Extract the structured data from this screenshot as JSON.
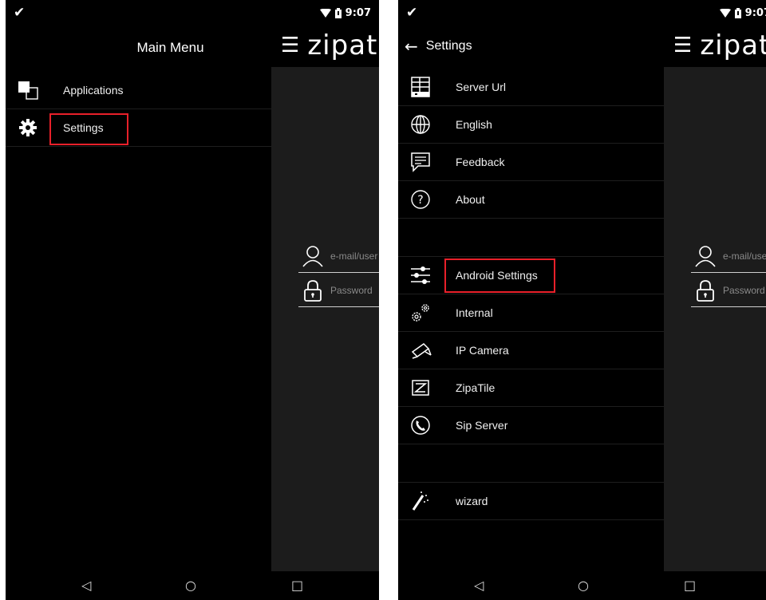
{
  "status": {
    "time": "9:07"
  },
  "app": {
    "logo": "zipato",
    "email_placeholder": "e-mail/user",
    "password_placeholder": "Password"
  },
  "left": {
    "title": "Main Menu",
    "items": [
      {
        "label": "Applications",
        "icon": "windows-icon"
      },
      {
        "label": "Settings",
        "icon": "gear-icon"
      }
    ]
  },
  "right": {
    "title": "Settings",
    "items": [
      {
        "label": "Server Url",
        "icon": "server-icon"
      },
      {
        "label": "English",
        "icon": "globe-icon"
      },
      {
        "label": "Feedback",
        "icon": "chat-icon"
      },
      {
        "label": "About",
        "icon": "question-icon"
      },
      {
        "label": "Android Settings",
        "icon": "sliders-icon"
      },
      {
        "label": "Internal",
        "icon": "gears-icon"
      },
      {
        "label": "IP Camera",
        "icon": "camera-icon"
      },
      {
        "label": "ZipaTile",
        "icon": "zipatile-icon"
      },
      {
        "label": "Sip Server",
        "icon": "phone-icon"
      },
      {
        "label": "wizard",
        "icon": "wand-icon"
      }
    ]
  },
  "colors": {
    "highlight": "#e8202a",
    "drawer": "#000000",
    "app_bg": "#1c1c1c"
  }
}
